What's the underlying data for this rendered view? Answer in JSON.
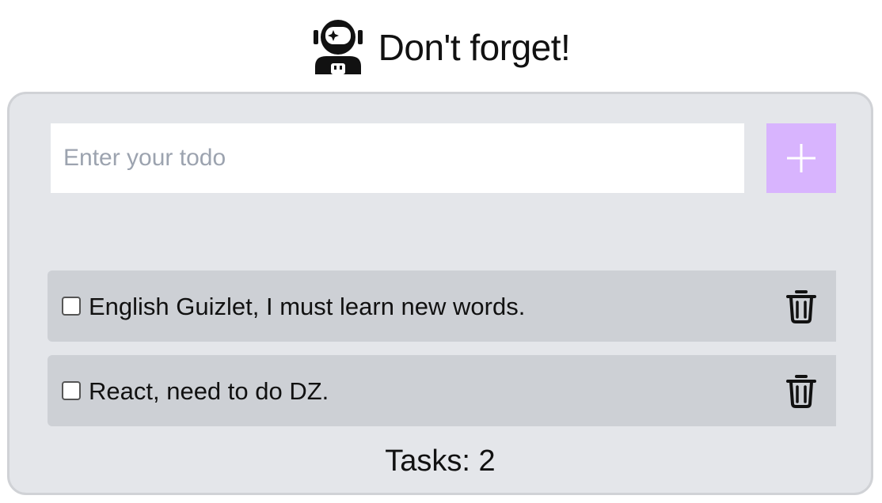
{
  "header": {
    "title": "Don't forget!",
    "logo_icon": "astronaut-icon"
  },
  "form": {
    "placeholder": "Enter your todo",
    "value": "",
    "add_icon": "plus-icon",
    "add_button_color": "#d8b4fe"
  },
  "todos": [
    {
      "text": "English Guizlet, I must learn new words.",
      "done": false,
      "delete_icon": "trash-icon"
    },
    {
      "text": "React, need to do DZ.",
      "done": false,
      "delete_icon": "trash-icon"
    }
  ],
  "footer": {
    "count_text": "Tasks: 2"
  },
  "colors": {
    "card_background": "#e4e6ea",
    "item_background": "#cdd0d5",
    "accent": "#d8b4fe"
  }
}
